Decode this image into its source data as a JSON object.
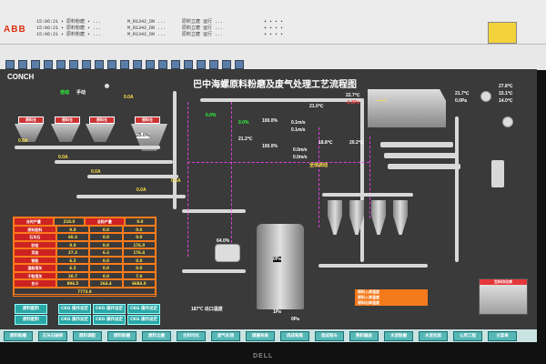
{
  "window": {
    "brand_logo": "ABB",
    "header_cells": [
      "0.0 ...",
      "...",
      "..."
    ]
  },
  "screen": {
    "title": "巴中海螺原料粉磨及废气处理工艺流程图",
    "brand": "CONCH"
  },
  "process": {
    "top_left_values": [
      "自动",
      "手动"
    ],
    "flow_values": [
      "0.0A",
      "0.0A",
      "0.0A",
      "0.0A",
      "0.0A",
      "0.0A",
      "0.0A",
      "0.0A"
    ],
    "temps": [
      "21.7℃",
      "21.2℃",
      "22.7℃",
      "21.0℃",
      "18.8℃",
      "20.2℃",
      "27.8℃",
      "15.1℃",
      "14.0℃"
    ],
    "speeds": [
      "100.0%",
      "100.0%",
      "0.1m/s",
      "0.1m/s",
      "0.0m/s",
      "0.0m/s"
    ],
    "pressures": [
      "-0.3Pa",
      "0.0Pa",
      "1Pa",
      "0Pa"
    ],
    "percent_small": [
      "0.0%",
      "0.0%",
      "64.0%",
      "25.0%"
    ],
    "mill_label": "0Pa",
    "bottom_note": "187℃ 出口温度",
    "mid_note": "全体启动"
  },
  "table": {
    "headers": [
      "台时产量",
      "210.0",
      "总粉产量",
      "0.0"
    ],
    "rows": [
      [
        "原料配料",
        "0.0",
        "0.0",
        "0.0"
      ],
      [
        "石灰石",
        "60.3",
        "0.0",
        "0.0"
      ],
      [
        "砂岩",
        "0.0",
        "0.0",
        "176.0"
      ],
      [
        "页岩",
        "27.3",
        "6.3",
        "176.4"
      ],
      [
        "铁粉",
        "6.5",
        "0.0",
        "0.0"
      ],
      [
        "湿粉煤灰",
        "6.5",
        "0.0",
        "0.0"
      ],
      [
        "干粉煤灰",
        "20.7",
        "0.0",
        "7.0"
      ],
      [
        "合计",
        "896.5",
        "264.4",
        "6684.0"
      ]
    ],
    "footer": "7773.9"
  },
  "small_buttons": [
    "原料配料",
    "CKG 操作设定",
    "CKG 操作设定",
    "CKG 操作设定",
    "原料配料",
    "CKG 操作设定",
    "CKG 操作设定",
    "CKG 操作设定"
  ],
  "status_box": [
    "原料入库温度",
    "原料入库温度",
    "原料出库温度"
  ],
  "panel": {
    "title": "生料均化库"
  },
  "bottom_nav": [
    "原料粉磨",
    "石灰石破碎",
    "原料调配",
    "原料粉磨",
    "原料立磨",
    "生料均化",
    "废气处理",
    "煤磨系统",
    "烧成窑尾",
    "烧成窑头",
    "熟料输送",
    "水泥粉磨",
    "水泥包装",
    "公用工程",
    "主菜单"
  ],
  "monitor_brand": "DELL"
}
